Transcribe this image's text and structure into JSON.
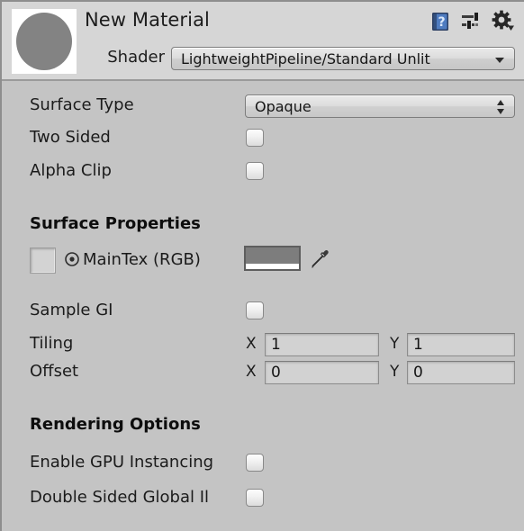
{
  "window": {
    "title": "New Material",
    "background_color": "#c4c4c4",
    "header_background_color": "#d6d6d6"
  },
  "header": {
    "material_name": "New Material",
    "preview_icon": "material-sphere-preview",
    "shader_label": "Shader",
    "shader_value": "LightweightPipeline/Standard Unlit",
    "icons": [
      {
        "name": "help-icon",
        "glyph": "?"
      },
      {
        "name": "preset-icon",
        "glyph": "sliders"
      },
      {
        "name": "gear-icon",
        "glyph": "gear"
      }
    ]
  },
  "body": {
    "surface_type": {
      "label": "Surface Type",
      "value": "Opaque"
    },
    "two_sided": {
      "label": "Two Sided",
      "checked": false
    },
    "alpha_clip": {
      "label": "Alpha Clip",
      "checked": false
    },
    "surface_properties": {
      "heading": "Surface Properties",
      "maintex": {
        "label": "MainTex (RGB)",
        "texture_value": "",
        "target_icon": "target-icon",
        "color_hex": "#7d7d7d",
        "eyedropper_icon": "eyedropper-icon"
      },
      "sample_gi": {
        "label": "Sample GI",
        "checked": false
      },
      "tiling": {
        "label": "Tiling",
        "x_label": "X",
        "x_value": "1",
        "y_label": "Y",
        "y_value": "1"
      },
      "offset": {
        "label": "Offset",
        "x_label": "X",
        "x_value": "0",
        "y_label": "Y",
        "y_value": "0"
      }
    },
    "rendering_options": {
      "heading": "Rendering Options",
      "gpu_instancing": {
        "label": "Enable GPU Instancing",
        "checked": false
      },
      "double_sided_gi": {
        "label": "Double Sided Global Il",
        "checked": false
      }
    }
  }
}
